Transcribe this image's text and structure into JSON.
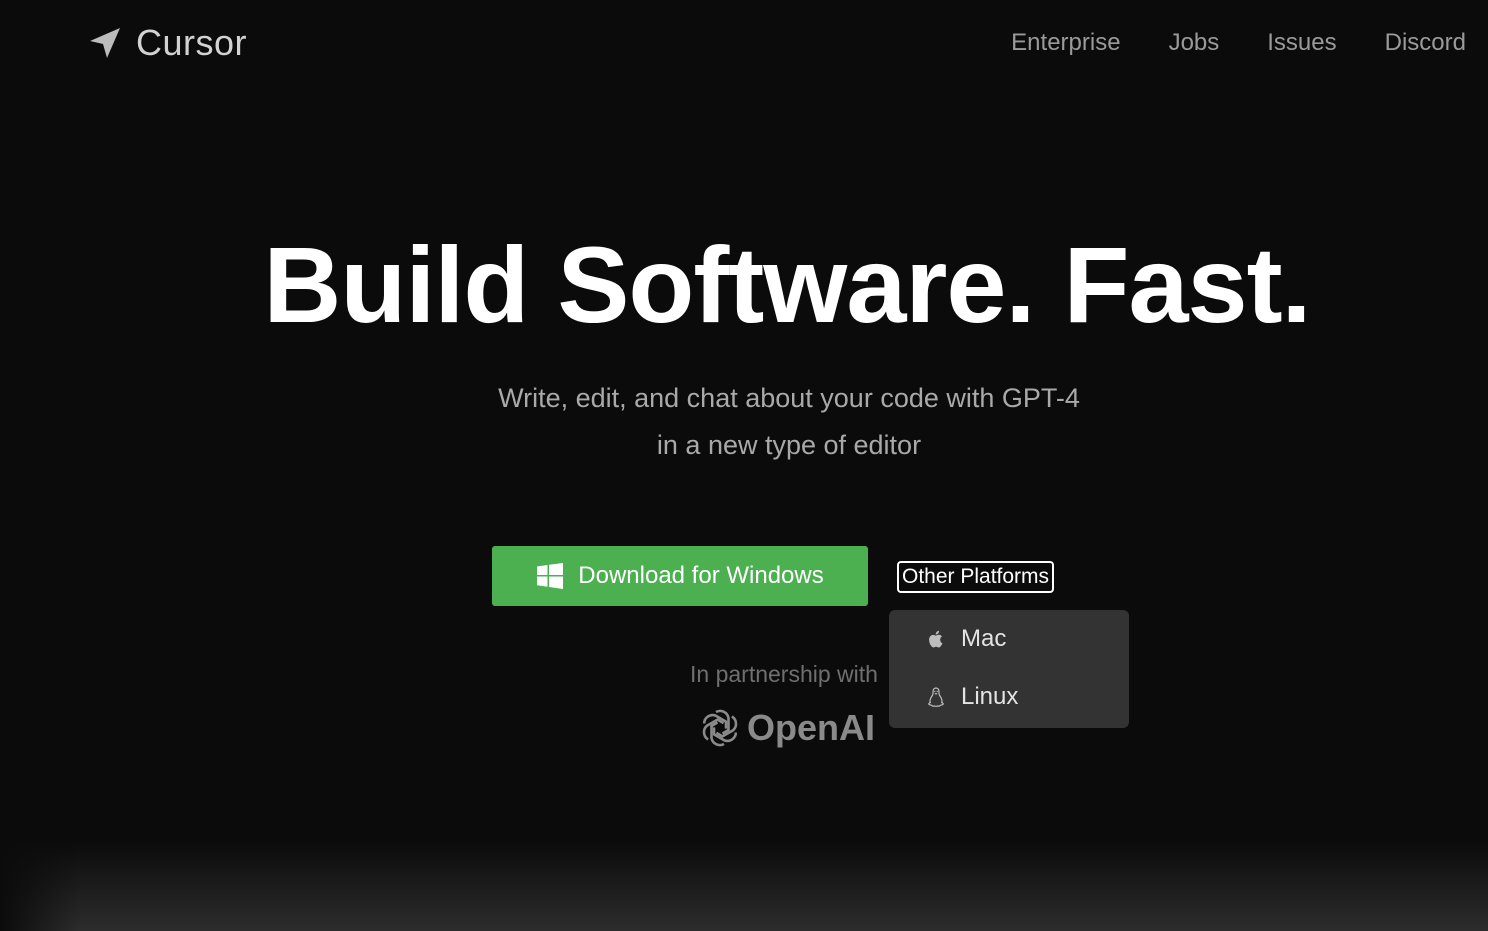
{
  "header": {
    "brand_name": "Cursor",
    "brand_icon": "navigation-arrow-icon",
    "nav": [
      {
        "label": "Enterprise"
      },
      {
        "label": "Jobs"
      },
      {
        "label": "Issues"
      },
      {
        "label": "Discord"
      }
    ]
  },
  "hero": {
    "headline": "Build Software. Fast.",
    "subline_1": "Write, edit, and chat about your code with GPT-4",
    "subline_2": "in a new type of editor"
  },
  "download": {
    "primary_label": "Download for Windows",
    "primary_icon": "windows-icon",
    "primary_color": "#4caf50",
    "other_label": "Other Platforms",
    "platforms": [
      {
        "label": "Mac",
        "icon": "apple-icon"
      },
      {
        "label": "Linux",
        "icon": "linux-penguin-icon"
      }
    ]
  },
  "partnership": {
    "text": "In partnership with",
    "logo_word": "OpenAI",
    "logo_icon": "openai-icon"
  },
  "colors": {
    "background": "#0b0b0b",
    "accent": "#4caf50",
    "dropdown_bg": "#333333"
  }
}
